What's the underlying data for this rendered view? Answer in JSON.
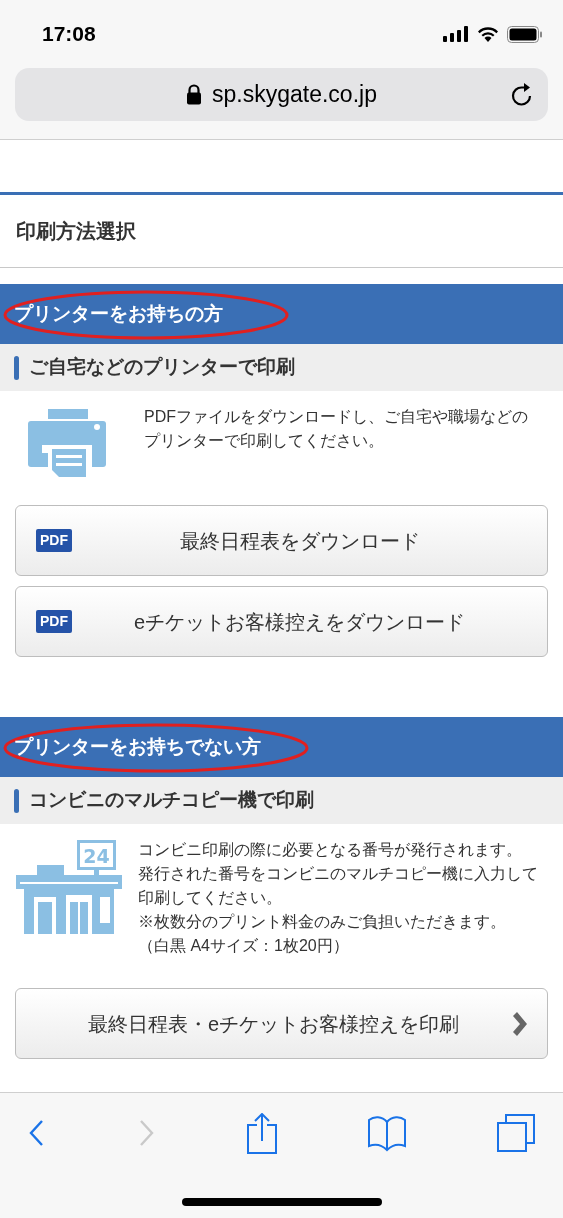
{
  "status_bar": {
    "time": "17:08"
  },
  "url_bar": {
    "url": "sp.skygate.co.jp"
  },
  "page_title": "印刷方法選択",
  "sections": [
    {
      "header": "プリンターをお持ちの方",
      "circled": true,
      "subheader": "ご自宅などのプリンターで印刷",
      "kind": "printer",
      "paragraphs": [
        "PDFファイルをダウンロードし、ご自宅や職場などのプリンターで印刷してください。"
      ],
      "buttons": [
        {
          "badge": "PDF",
          "label": "最終日程表をダウンロード",
          "arrow": false
        },
        {
          "badge": "PDF",
          "label": "eチケットお客様控えをダウンロード",
          "arrow": false
        }
      ]
    },
    {
      "header": "プリンターをお持ちでない方",
      "circled": true,
      "subheader": "コンビニのマルチコピー機で印刷",
      "kind": "store",
      "store_sign": "24",
      "paragraphs": [
        "コンビニ印刷の際に必要となる番号が発行されます。",
        "発行された番号をコンビニのマルチコピー機に入力して印刷してください。",
        "※枚数分のプリント料金のみご負担いただきます。",
        "（白黒 A4サイズ：1枚20円）"
      ],
      "buttons": [
        {
          "label": "最終日程表・eチケットお客様控えを印刷",
          "arrow": true
        }
      ]
    }
  ],
  "toolbar": [
    {
      "kind": "back",
      "disabled": false
    },
    {
      "kind": "forward",
      "disabled": true
    },
    {
      "kind": "share",
      "disabled": false
    },
    {
      "kind": "bookmarks",
      "disabled": false
    },
    {
      "kind": "tabs",
      "disabled": false
    }
  ]
}
